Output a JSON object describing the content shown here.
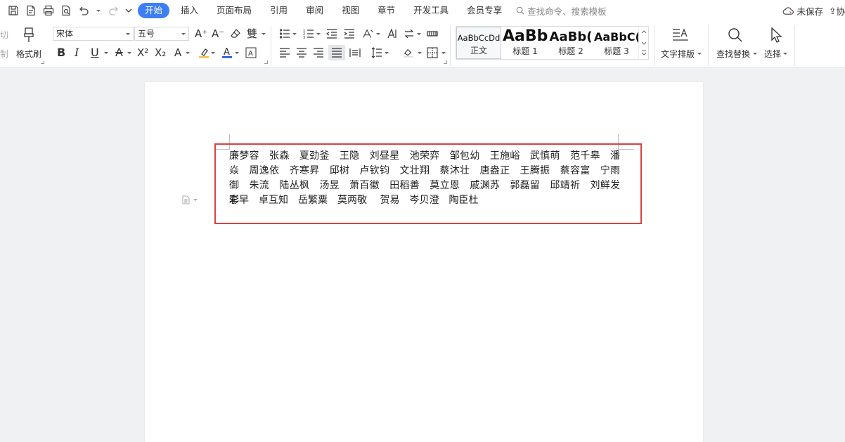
{
  "menubar": {
    "tabs": [
      "开始",
      "插入",
      "页面布局",
      "引用",
      "审阅",
      "视图",
      "章节",
      "开发工具",
      "会员专享"
    ],
    "active_tab": "开始",
    "search_placeholder": "查找命令、搜索模板",
    "save_status": "未保存",
    "overflow_text": "协"
  },
  "ribbon": {
    "clipboard": {
      "cut": "切",
      "copy": "制",
      "format_painter": "格式刷"
    },
    "font": {
      "family": "宋体",
      "size": "五号"
    },
    "styles": [
      {
        "sample": "AaBbCcDd",
        "name": "正文"
      },
      {
        "sample": "AaBb",
        "name": "标题 1"
      },
      {
        "sample": "AaBb(",
        "name": "标题 2"
      },
      {
        "sample": "AaBbC(",
        "name": "标题 3"
      }
    ],
    "text_layout": "文字排版",
    "find_replace": "查找替换",
    "select": "选择"
  },
  "document": {
    "names_text": "廉梦容　张森　夏劲釜　王隐　刘昼星　池荣弈　邹包幼　王施峪　武慎萌　范千皋　潘焱　周逸依　齐寒昇　邱树　卢钦钧　文壮翔　蔡沐壮　唐盎正　王腾振　蔡容富　宁雨御　朱流　陆丛枫　汤昱　萧百徽　田稻善　莫立恩　戚渊苏　郭磊留　邱靖祈　刘鲜发　李",
    "names_last_line": "彩早　卓互知　岳繁粟　莫两敬　 贺易　岑贝澄　陶臣杜"
  }
}
